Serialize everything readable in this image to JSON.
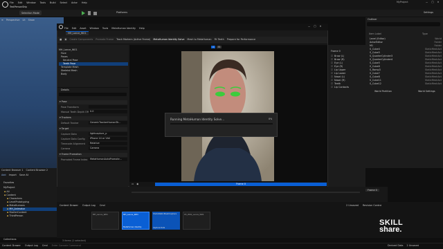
{
  "window": {
    "title": "MyProject",
    "tab": "TestPersonShip",
    "menu": [
      "File",
      "Edit",
      "Window",
      "Tools",
      "Build",
      "Select",
      "Actor",
      "Help"
    ],
    "selection_mode": "Selection Mode",
    "platforms": "Platforms",
    "settings": "Settings"
  },
  "viewport": {
    "mode": "Perspective",
    "lit": "Lit",
    "show": "Show"
  },
  "outliner": {
    "title": "Outliner",
    "col_label": "Item Label",
    "col_type": "Type",
    "items": [
      {
        "label": "Level (Editor)",
        "type": "World"
      },
      {
        "label": "ActorEditor",
        "type": "Folder"
      },
      {
        "label": "M1",
        "type": "Folder"
      },
      {
        "label": "S_Cube4",
        "type": "StaticMeshAct"
      },
      {
        "label": "S_Cube5",
        "type": "StaticMeshAct"
      },
      {
        "label": "S_QuarterCylinder3",
        "type": "StaticMeshAct"
      },
      {
        "label": "S_QuarterCylinder4",
        "type": "StaticMeshAct"
      },
      {
        "label": "S_Cube5",
        "type": "StaticMeshAct"
      },
      {
        "label": "S_Cube6",
        "type": "StaticMeshAct"
      },
      {
        "label": "S_Ramp3",
        "type": "StaticMeshAct"
      },
      {
        "label": "S_Cube7",
        "type": "StaticMeshAct"
      },
      {
        "label": "S_Cube8",
        "type": "StaticMeshAct"
      },
      {
        "label": "S_Cube11",
        "type": "StaticMeshAct"
      },
      {
        "label": "S_Cube12",
        "type": "StaticMeshAct"
      }
    ],
    "details_tab": "World Partition",
    "world_settings_tab": "World Settings"
  },
  "asset": {
    "title": "MH_Lance_W01",
    "menu": [
      "File",
      "Edit",
      "Asset",
      "Window",
      "Tools",
      "MetaHuman Identity",
      "Help"
    ],
    "toolbar": {
      "save": "Save",
      "browse": "Browse",
      "create_comp": "Create Components",
      "promote": "Promote Frame",
      "track_markers": "Track Markers (Active Frame)",
      "identity_solve": "MetaHuman Identity Solve",
      "mesh_to_mh": "Mesh to MetaHuman",
      "fit_teeth": "Fit Teeth",
      "prepare": "Prepare for Performance"
    },
    "tree": [
      "MH_Lance_W01",
      "Face",
      "Poses",
      "Neutral Pose",
      "Teeth Pose",
      "Template Mesh",
      "Skeletal Mesh",
      "Body"
    ],
    "details_title": "Details",
    "sections": [
      {
        "name": "Pose",
        "rows": [
          {
            "label": "Pose Transform",
            "value": ""
          },
          {
            "label": "Manual Teeth Depth Offset",
            "value": "0.0"
          }
        ]
      },
      {
        "name": "Trackers",
        "rows": [
          {
            "label": "Default Tracker",
            "value": "GenericTrackerHumanTe..."
          }
        ]
      },
      {
        "name": "Target",
        "rows": [
          {
            "label": "Capture Data",
            "value": "lightcapture_p"
          },
          {
            "label": "Capture Data Config",
            "value": "iPhone 14 or Vidi"
          },
          {
            "label": "Timecode Alignment",
            "value": "Relative"
          },
          {
            "label": "Camera",
            "value": "Camera"
          }
        ]
      },
      {
        "name": "Frame Promotion",
        "rows": [
          {
            "label": "Promoted Frame Index",
            "value": "MetaHumanAutoPromote..."
          }
        ]
      }
    ],
    "frame_list": {
      "header": "Frame 0",
      "items": [
        "Brow (L)",
        "Brow (R)",
        "Eye (L)",
        "Eye (R)",
        "Lip Upper",
        "Lip Lower",
        "Nasal (L)",
        "Nasal (R)",
        "Teeth",
        "Lip Contacts"
      ]
    },
    "viewport": {
      "view_a": "A",
      "view_b": "B",
      "frame_label": "Frame 0"
    }
  },
  "progress": {
    "message": "Running MetaHuman Identity Solve...",
    "percent": "0%",
    "value": 0
  },
  "sequencer": {
    "frame_display": "Frame 0"
  },
  "content_browser": {
    "tabs": [
      "Content Browser 1",
      "Content Browser 2"
    ],
    "add": "Add",
    "import": "Import",
    "save_all": "Save All",
    "path": [
      "All",
      "Content",
      "MetaHumans"
    ],
    "favorites": "Favorites",
    "project": "MyProject",
    "folders": [
      "All",
      "Content",
      "Characters",
      "LevelPrototyping",
      "MetaHumans",
      "MH_Animator",
      "StarterContent",
      "ThirdPerson"
    ],
    "settings": "Settings",
    "assets": [
      {
        "name": "MH_Lance_W01",
        "type": "MetaHuman Identity"
      },
      {
        "name": "ShotsStaticMeshCapture",
        "type": "Capture Data"
      },
      {
        "name": "03_W01_Lance_W01",
        "type": ""
      }
    ],
    "item_count": "3 items (1 selected)",
    "collections": "Collections"
  },
  "bottom": {
    "content_drawer": "Content Drawer",
    "output_log": "Output Log",
    "cmd": "Cmd",
    "console_placeholder": "Enter Console Command",
    "tabs": [
      "Content Drawer",
      "Output Log"
    ],
    "cmd2": "Cmd",
    "derived": "Derived Data",
    "unsaved": "2 Unsaved",
    "revision": "Revision Control"
  },
  "watermark": {
    "line1": "SKILL",
    "line2": "share."
  }
}
